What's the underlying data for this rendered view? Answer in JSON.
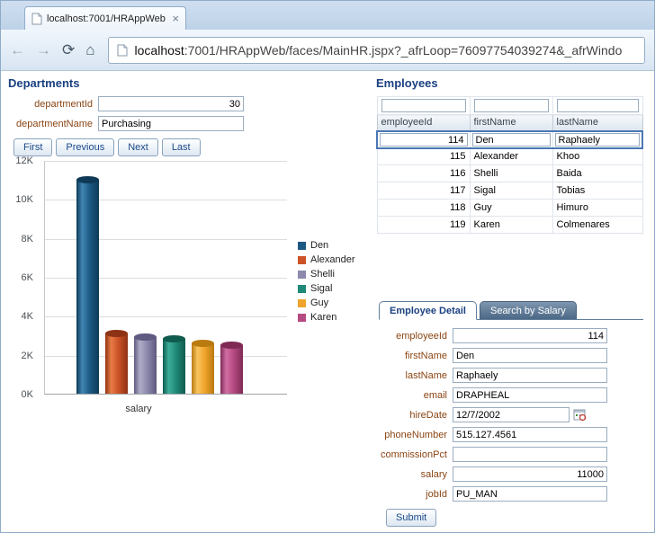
{
  "browser": {
    "tab_title": "localhost:7001/HRAppWeb",
    "tab_close_glyph": "×",
    "url_host": "localhost",
    "url_rest": ":7001/HRAppWeb/faces/MainHR.jspx?_afrLoop=76097754039274&_afrWindo",
    "nav_icons": [
      {
        "name": "back-arrow",
        "glyph": "←",
        "enabled": false
      },
      {
        "name": "forward-arrow",
        "glyph": "→",
        "enabled": false
      },
      {
        "name": "reload",
        "glyph": "⟳",
        "enabled": true
      },
      {
        "name": "home",
        "glyph": "⌂",
        "enabled": true
      }
    ]
  },
  "departments": {
    "title": "Departments",
    "fields": [
      {
        "label": "departmentId",
        "value": "30",
        "align": "right"
      },
      {
        "label": "departmentName",
        "value": "Purchasing",
        "align": "left"
      }
    ],
    "buttons": [
      "First",
      "Previous",
      "Next",
      "Last"
    ]
  },
  "chart_data": {
    "type": "bar",
    "categories": [
      "Den",
      "Alexander",
      "Shelli",
      "Sigal",
      "Guy",
      "Karen"
    ],
    "values": [
      11000,
      3100,
      2900,
      2800,
      2600,
      2500
    ],
    "series_colors": [
      {
        "base": "#1c5a85",
        "light": "#4286b4",
        "dark": "#0e3a57"
      },
      {
        "base": "#cc5227",
        "light": "#e87c45",
        "dark": "#8e3215"
      },
      {
        "base": "#8d89ad",
        "light": "#b0adc9",
        "dark": "#5f5a80"
      },
      {
        "base": "#1f8a78",
        "light": "#3fae99",
        "dark": "#0f5b4e"
      },
      {
        "base": "#f0a42c",
        "light": "#f8c45e",
        "dark": "#b97a10"
      },
      {
        "base": "#b64a82",
        "light": "#d06fa3",
        "dark": "#7e2a55"
      }
    ],
    "title": "",
    "xlabel": "salary",
    "ylabel": "",
    "ylim": [
      0,
      12000
    ],
    "ytick_labels": [
      "0K",
      "2K",
      "4K",
      "6K",
      "8K",
      "10K",
      "12K"
    ],
    "grid": true,
    "legend_position": "right"
  },
  "employees": {
    "title": "Employees",
    "columns": [
      "employeeId",
      "firstName",
      "lastName"
    ],
    "filter_values": [
      "",
      "",
      ""
    ],
    "rows": [
      [
        "114",
        "Den",
        "Raphaely"
      ],
      [
        "115",
        "Alexander",
        "Khoo"
      ],
      [
        "116",
        "Shelli",
        "Baida"
      ],
      [
        "117",
        "Sigal",
        "Tobias"
      ],
      [
        "118",
        "Guy",
        "Himuro"
      ],
      [
        "119",
        "Karen",
        "Colmenares"
      ]
    ],
    "selected_row": 0
  },
  "detail": {
    "tabs": [
      "Employee Detail",
      "Search by Salary"
    ],
    "active_tab": 0,
    "fields": [
      {
        "label": "employeeId",
        "value": "114",
        "align": "right"
      },
      {
        "label": "firstName",
        "value": "Den",
        "align": "left"
      },
      {
        "label": "lastName",
        "value": "Raphaely",
        "align": "left"
      },
      {
        "label": "email",
        "value": "DRAPHEAL",
        "align": "left"
      },
      {
        "label": "hireDate",
        "value": "12/7/2002",
        "align": "left",
        "short": true,
        "icon": "calendar-picker-icon"
      },
      {
        "label": "phoneNumber",
        "value": "515.127.4561",
        "align": "left"
      },
      {
        "label": "commissionPct",
        "value": "",
        "align": "left"
      },
      {
        "label": "salary",
        "value": "11000",
        "align": "right"
      },
      {
        "label": "jobId",
        "value": "PU_MAN",
        "align": "left"
      }
    ],
    "submit_label": "Submit"
  }
}
